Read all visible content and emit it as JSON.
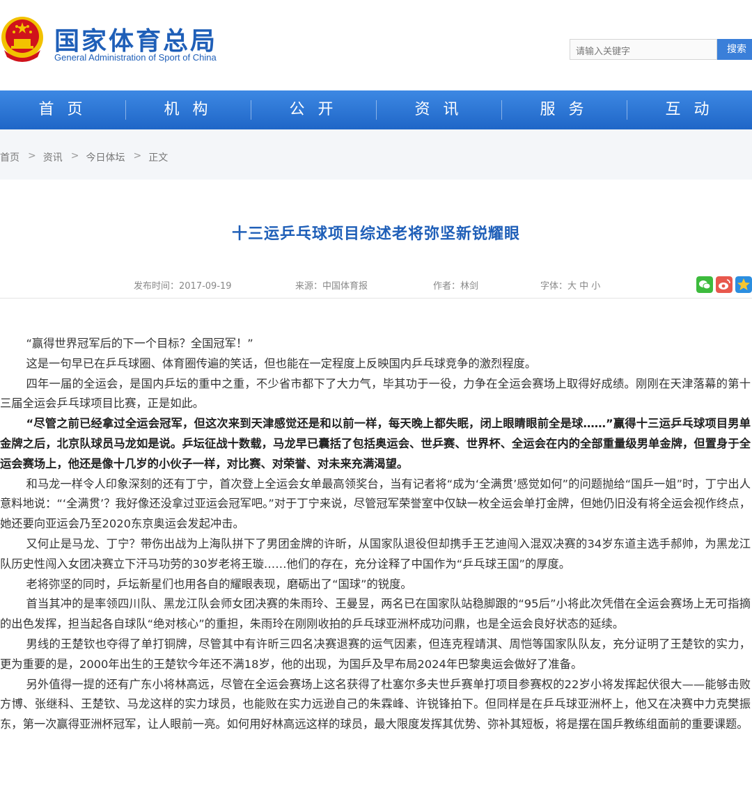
{
  "header": {
    "site_title": "国家体育总局",
    "site_subtitle": "General Administration of Sport of China",
    "search_placeholder": "请输入关键字",
    "search_button": "搜索"
  },
  "nav": [
    "首 页",
    "机 构",
    "公 开",
    "资 讯",
    "服 务",
    "互 动"
  ],
  "breadcrumb": [
    "首页",
    "资讯",
    "今日体坛",
    "正文"
  ],
  "breadcrumb_sep": ">",
  "article": {
    "title": "十三运乒乓球项目综述老将弥坚新锐耀眼",
    "publish_time": "发布时间：2017-09-19",
    "source": "来源：中国体育报",
    "author": "作者：林剑",
    "font_size": "字体：大 中 小",
    "paragraphs": [
      "“赢得世界冠军后的下一个目标？全国冠军！”",
      "这是一句早已在乒乓球圈、体育圈传遍的笑话，但也能在一定程度上反映国内乒乓球竞争的激烈程度。",
      "四年一届的全运会，是国内乒坛的重中之重，不少省市都下了大力气，毕其功于一役，力争在全运会赛场上取得好成绩。刚刚在天津落幕的第十三届全运会乒乓球项目比赛，正是如此。",
      "“尽管之前已经拿过全运会冠军，但这次来到天津感觉还是和以前一样，每天晚上都失眠，闭上眼睛眼前全是球……”赢得十三运乒乓球项目男单金牌之后，北京队球员马龙如是说。乒坛征战十数载，马龙早已囊括了包括奥运会、世乒赛、世界杯、全运会在内的全部重量级男单金牌，但置身于全运会赛场上，他还是像十几岁的小伙子一样，对比赛、对荣誉、对未来充满渴望。",
      "和马龙一样令人印象深刻的还有丁宁，首次登上全运会女单最高领奖台，当有记者将“成为‘全满贯’感觉如何”的问题抛给“国乒一姐”时，丁宁出人意料地说：“‘全满贯’？我好像还没拿过亚运会冠军吧。”对于丁宁来说，尽管冠军荣誉室中仅缺一枚全运会单打金牌，但她仍旧没有将全运会视作终点，她还要向亚运会乃至2020东京奥运会发起冲击。",
      "又何止是马龙、丁宁？带伤出战为上海队拼下了男团金牌的许昕，从国家队退役但却携手王艺迪闯入混双决赛的34岁东道主选手郝帅，为黑龙江队历史性闯入女团决赛立下汗马功劳的30岁老将王璇……他们的存在，充分诠释了中国作为“乒乓球王国”的厚度。",
      "老将弥坚的同时，乒坛新星们也用各自的耀眼表现，磨砺出了“国球”的锐度。",
      "首当其冲的是率领四川队、黑龙江队会师女团决赛的朱雨玲、王曼昱，两名已在国家队站稳脚跟的“95后”小将此次凭借在全运会赛场上无可指摘的出色发挥，担当起各自球队“绝对核心”的重担，朱雨玲在刚刚收拍的乒乓球亚洲杯成功问鼎，也是全运会良好状态的延续。",
      "男线的王楚钦也夺得了单打铜牌，尽管其中有许昕三四名决赛退赛的运气因素，但连克程靖淇、周恺等国家队队友，充分证明了王楚钦的实力，更为重要的是，2000年出生的王楚钦今年还不满18岁，他的出现，为国乒及早布局2024年巴黎奥运会做好了准备。",
      "另外值得一提的还有广东小将林高远，尽管在全运会赛场上这名获得了杜塞尔多夫世乒赛单打项目参赛权的22岁小将发挥起伏很大——能够击败方博、张继科、王楚钦、马龙这样的实力球员，也能败在实力远逊自己的朱霖峰、许锐锋拍下。但同样是在乒乓球亚洲杯上，他又在决赛中力克樊振东，第一次赢得亚洲杯冠军，让人眼前一亮。如何用好林高远这样的球员，最大限度发挥其优势、弥补其短板，将是摆在国乒教练组面前的重要课题。"
    ]
  },
  "colors": {
    "brand_blue": "#1f5fb8",
    "nav_blue": "#2a74d4",
    "emblem_red": "#d0121b",
    "emblem_gold": "#f2c200"
  },
  "icons": [
    "national-emblem-icon",
    "wechat-icon",
    "weibo-icon",
    "qzone-icon"
  ]
}
